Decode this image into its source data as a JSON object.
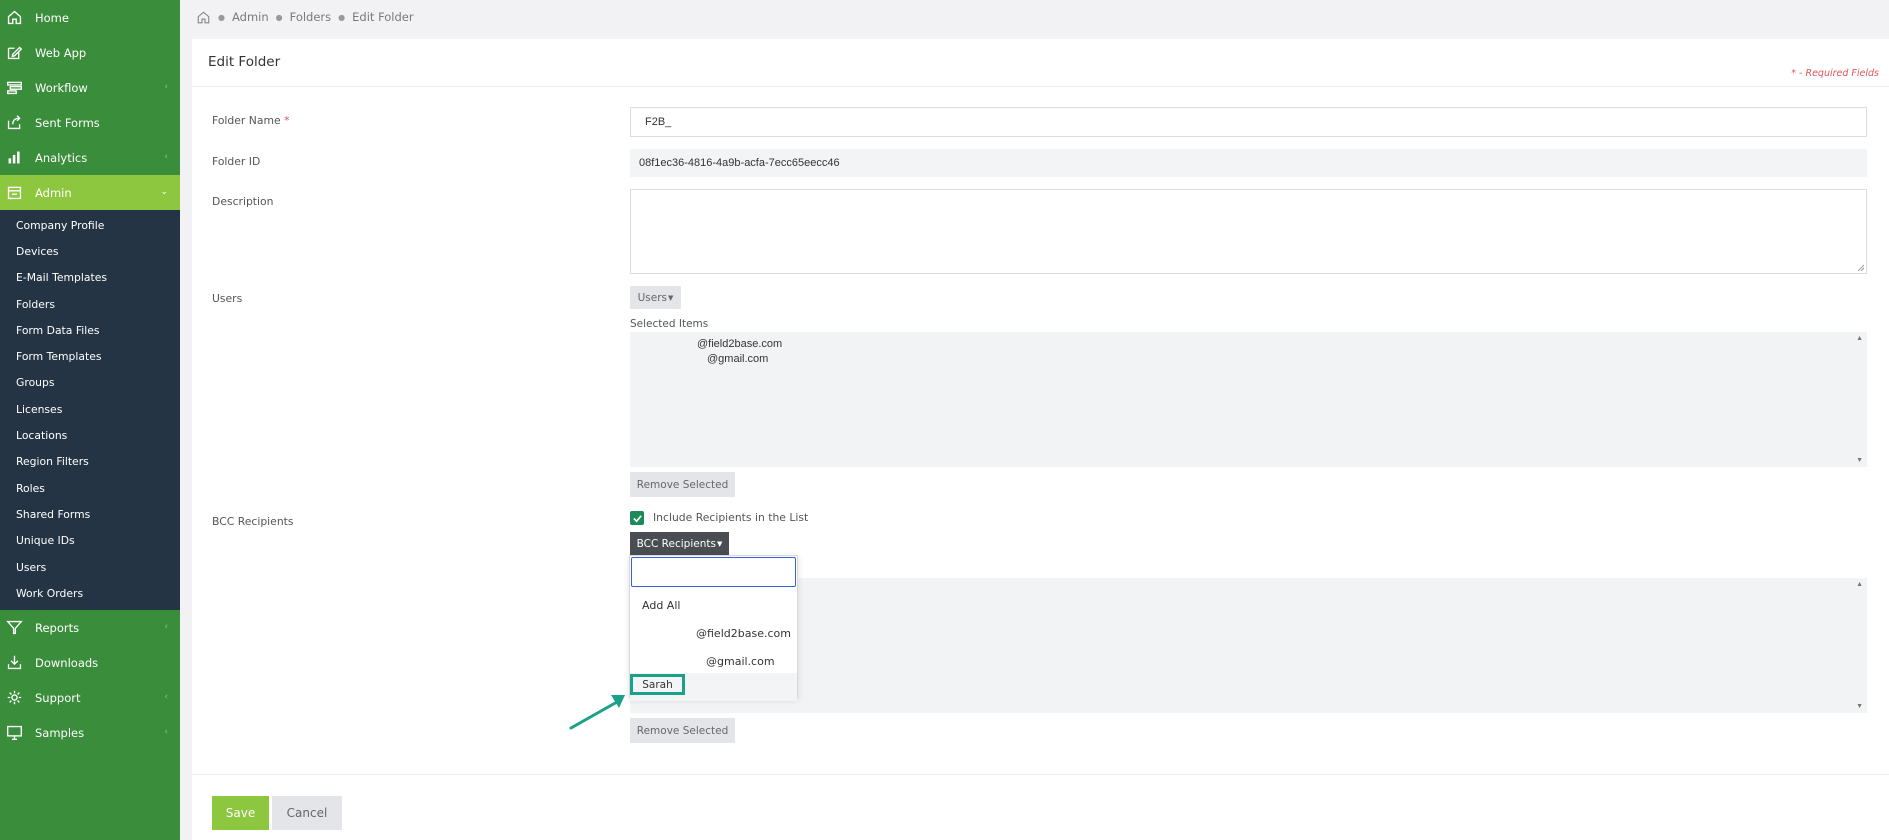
{
  "sidebar": {
    "top_items": [
      {
        "label": "Home",
        "icon": "home-icon"
      },
      {
        "label": "Web App",
        "icon": "edit-icon"
      },
      {
        "label": "Workflow",
        "icon": "workflow-icon"
      },
      {
        "label": "Sent Forms",
        "icon": "share-icon"
      },
      {
        "label": "Analytics",
        "icon": "bar-chart-icon"
      },
      {
        "label": "Admin",
        "icon": "admin-icon"
      }
    ],
    "admin_sub_items": [
      {
        "label": "Company Profile"
      },
      {
        "label": "Devices"
      },
      {
        "label": "E-Mail Templates"
      },
      {
        "label": "Folders"
      },
      {
        "label": "Form Data Files"
      },
      {
        "label": "Form Templates"
      },
      {
        "label": "Groups"
      },
      {
        "label": "Licenses"
      },
      {
        "label": "Locations"
      },
      {
        "label": "Region Filters"
      },
      {
        "label": "Roles"
      },
      {
        "label": "Shared Forms"
      },
      {
        "label": "Unique IDs"
      },
      {
        "label": "Users"
      },
      {
        "label": "Work Orders"
      }
    ],
    "bottom_items": [
      {
        "label": "Reports",
        "icon": "filter-icon"
      },
      {
        "label": "Downloads",
        "icon": "download-icon"
      },
      {
        "label": "Support",
        "icon": "gear-icon"
      },
      {
        "label": "Samples",
        "icon": "monitor-icon"
      }
    ],
    "active_color": "#8dc63f",
    "bg_color": "#3a8d3a",
    "sub_bg_color": "#243445"
  },
  "breadcrumb": {
    "items": [
      "Admin",
      "Folders",
      "Edit Folder"
    ]
  },
  "form": {
    "title": "Edit Folder",
    "required_note": "* - Required Fields",
    "folder_name_label": "Folder Name",
    "folder_name_star": "*",
    "folder_name_value": "F2B_",
    "folder_id_label": "Folder ID",
    "folder_id_value": "08f1ec36-4816-4a9b-acfa-7ecc65eecc46",
    "description_label": "Description",
    "users_label": "Users",
    "users_button": "Users",
    "selected_items_label": "Selected Items",
    "selected_users": [
      "@field2base.com",
      "@gmail.com"
    ],
    "remove_selected_label": "Remove Selected",
    "bcc_label": "BCC Recipients",
    "include_recipients_label": "Include Recipients in the List",
    "bcc_button": "BCC Recipients",
    "bcc_remove_selected_label": "Remove Selected",
    "save_label": "Save",
    "cancel_label": "Cancel"
  },
  "bcc_dropdown": {
    "search_value": "",
    "items": [
      {
        "label": "Add All"
      },
      {
        "label": "@field2base.com"
      },
      {
        "label": "@gmail.com"
      },
      {
        "label": "Sarah"
      }
    ]
  },
  "colors": {
    "accent": "#8dc63f",
    "highlight_box": "#1ba08a",
    "dropdown_focus": "#3b5fd9"
  }
}
